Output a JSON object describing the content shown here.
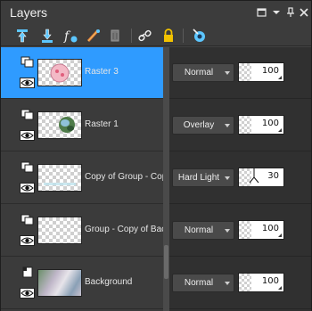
{
  "panel": {
    "title": "Layers"
  },
  "toolbar": {
    "icons": [
      "new-raster-layer-icon",
      "new-vector-layer-icon",
      "new-adjustment-layer-icon",
      "new-mask-layer-icon",
      "delete-layer-icon",
      "link-layer-icon",
      "lock-layer-icon",
      "visibility-toggle-icon"
    ]
  },
  "layers": [
    {
      "name": "Raster 3",
      "blend": "Normal",
      "opacity": "100",
      "opacity_fraction": 1.0,
      "selected": true
    },
    {
      "name": "Raster 1",
      "blend": "Overlay",
      "opacity": "100",
      "opacity_fraction": 1.0,
      "selected": false
    },
    {
      "name": "Copy of Group - Copy o",
      "blend": "Hard Light",
      "opacity": "30",
      "opacity_fraction": 0.3,
      "selected": false
    },
    {
      "name": "Group - Copy of Backgr",
      "blend": "Normal",
      "opacity": "100",
      "opacity_fraction": 1.0,
      "selected": false
    },
    {
      "name": "Background",
      "blend": "Normal",
      "opacity": "100",
      "opacity_fraction": 1.0,
      "selected": false
    }
  ],
  "colors": {
    "selected": "#2f9bff",
    "accent_icon": "#5cc6ff"
  }
}
